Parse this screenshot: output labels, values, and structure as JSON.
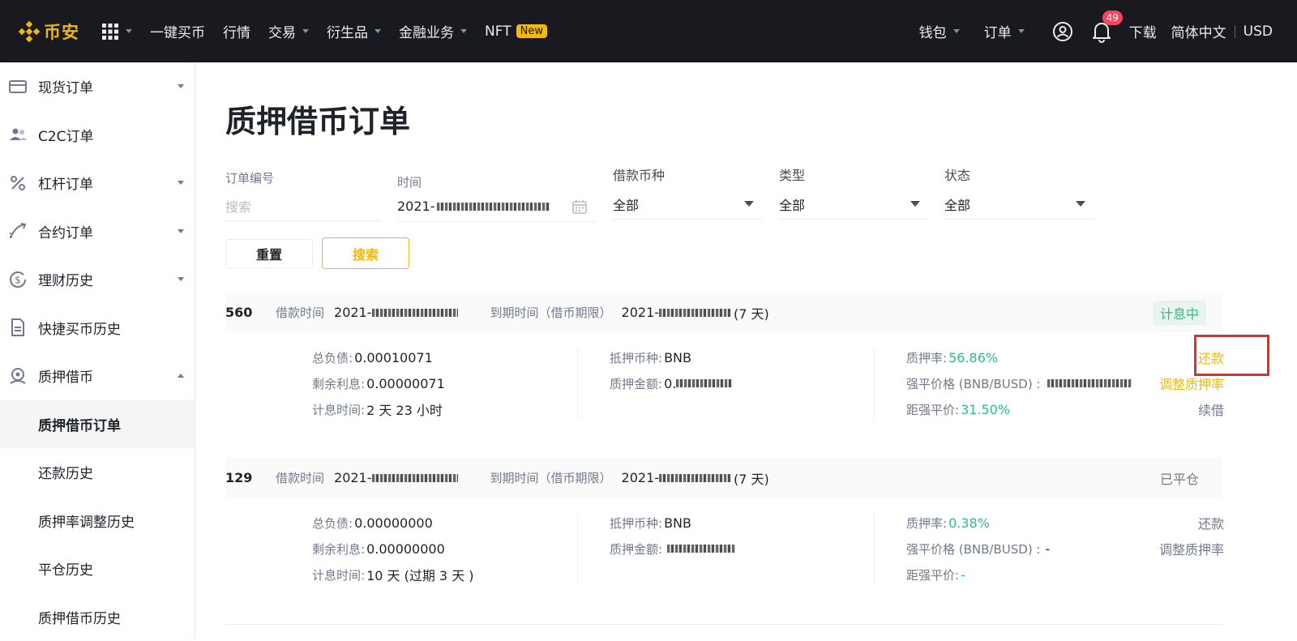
{
  "header": {
    "logo_text": "币安",
    "nav": [
      "一键买币",
      "行情",
      "交易",
      "衍生品",
      "金融业务",
      "NFT"
    ],
    "nft_badge": "New",
    "wallet": "钱包",
    "orders": "订单",
    "notification_count": "49",
    "download": "下载",
    "language": "简体中文",
    "currency": "USD"
  },
  "sidebar": {
    "items": [
      {
        "label": "现货订单"
      },
      {
        "label": "C2C订单"
      },
      {
        "label": "杠杆订单"
      },
      {
        "label": "合约订单"
      },
      {
        "label": "理财历史"
      },
      {
        "label": "快捷买币历史"
      },
      {
        "label": "质押借币"
      },
      {
        "label": "质押借币订单"
      },
      {
        "label": "还款历史"
      },
      {
        "label": "质押率调整历史"
      },
      {
        "label": "平仓历史"
      },
      {
        "label": "质押借币历史"
      }
    ]
  },
  "page": {
    "title": "质押借币订单"
  },
  "filters": {
    "order_id_label": "订单编号",
    "order_id_placeholder": "搜索",
    "time_label": "时间",
    "time_value": "2021-",
    "coin_label": "借款币种",
    "coin_value": "全部",
    "type_label": "类型",
    "type_value": "全部",
    "status_label": "状态",
    "status_value": "全部",
    "reset": "重置",
    "search": "搜索"
  },
  "orders": [
    {
      "id": "560",
      "borrow_time_label": "借款时间",
      "borrow_time": "2021-",
      "due_label": "到期时间（借币期限）",
      "due_time": "2021-",
      "term": "(7 天)",
      "status": "计息中",
      "total_debt_label": "总负债:",
      "total_debt": "0.00010071",
      "interest_label": "剩余利息:",
      "interest": "0.00000071",
      "accrual_label": "计息时间:",
      "accrual": "2 天 23 小时",
      "collateral_coin_label": "抵押币种:",
      "collateral_coin": "BNB",
      "collateral_amount_label": "质押金额:",
      "collateral_amount": "0.",
      "ltv_label": "质押率:",
      "ltv": "56.86%",
      "liq_price_label": "强平价格 (BNB/BUSD) :",
      "liq_price": "",
      "liq_dist_label": "距强平价:",
      "liq_dist": "31.50%",
      "actions": [
        "还款",
        "调整质押率",
        "续借"
      ]
    },
    {
      "id": "129",
      "borrow_time_label": "借款时间",
      "borrow_time": "2021-",
      "due_label": "到期时间（借币期限）",
      "due_time": "2021-",
      "term": "(7 天)",
      "status": "已平仓",
      "total_debt_label": "总负债:",
      "total_debt": "0.00000000",
      "interest_label": "剩余利息:",
      "interest": "0.00000000",
      "accrual_label": "计息时间:",
      "accrual": "10 天 (过期 3 天 )",
      "collateral_coin_label": "抵押币种:",
      "collateral_coin": "BNB",
      "collateral_amount_label": "质押金额:",
      "collateral_amount": "",
      "ltv_label": "质押率:",
      "ltv": "0.38%",
      "liq_price_label": "强平价格 (BNB/BUSD) :",
      "liq_price": "-",
      "liq_dist_label": "距强平价:",
      "liq_dist": "-",
      "actions": [
        "还款",
        "调整质押率"
      ]
    }
  ],
  "colors": {
    "brand": "#f0b90b",
    "topbar": "#181a20",
    "positive": "#2ebd85",
    "highlight": "#d9302b"
  }
}
